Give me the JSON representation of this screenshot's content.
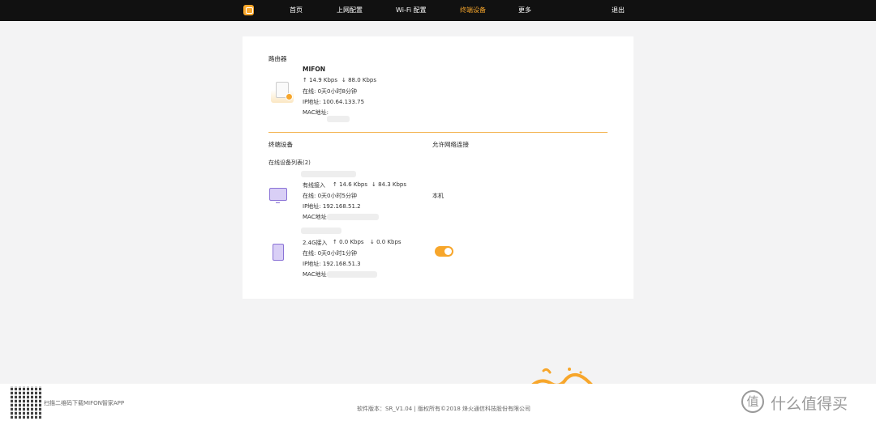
{
  "nav": {
    "home": "首页",
    "internet": "上网配置",
    "wifi": "Wi-Fi 配置",
    "devices": "终端设备",
    "more": "更多",
    "logout": "退出"
  },
  "router": {
    "section_title": "路由器",
    "name": "MIFON",
    "up": "↑  14.9 Kbps",
    "down": "↓  88.0 Kbps",
    "online": "在线:   0天0小时8分钟",
    "ip": "IP地址:   100.64.133.75",
    "mac": "MAC地址:"
  },
  "devices": {
    "section_title": "终端设备",
    "allow_title": "允许网络连接",
    "list_title": "在线设备列表(2)",
    "items": [
      {
        "conn": "有线接入",
        "up": "↑  14.6 Kbps",
        "down": "↓  84.3 Kbps",
        "online": "在线:   0天0小时5分钟",
        "ip": "IP地址:   192.168.51.2",
        "mac": "MAC地址:",
        "status": "本机"
      },
      {
        "conn": "2.4G接入",
        "up": "↑  0.0 Kbps",
        "down": "↓  0.0 Kbps",
        "online": "在线:   0天0小时1分钟",
        "ip": "IP地址:   192.168.51.3",
        "mac": "MAC地址:",
        "allowed": true
      }
    ]
  },
  "footer": {
    "qr_text": "扫描二维码下载MIFON智家APP",
    "copyright": "软件版本：SR_V1.04 | 版权所有©2018 烽火通信科技股份有限公司",
    "watermark_icon": "值",
    "watermark_text": "什么值得买"
  },
  "colors": {
    "accent": "#f7a62b",
    "topbar": "#111111",
    "device_icon": "#8a72d6"
  }
}
